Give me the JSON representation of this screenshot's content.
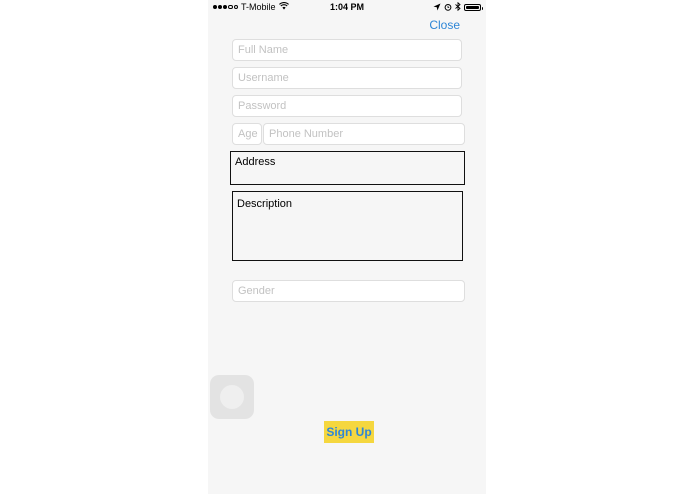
{
  "status_bar": {
    "carrier": "T-Mobile",
    "time": "1:04 PM"
  },
  "header": {
    "close_label": "Close"
  },
  "form": {
    "full_name_placeholder": "Full Name",
    "username_placeholder": "Username",
    "password_placeholder": "Password",
    "age_placeholder": "Age",
    "phone_placeholder": "Phone Number",
    "address_label": "Address",
    "description_label": "Description",
    "gender_placeholder": "Gender"
  },
  "actions": {
    "sign_up_label": "Sign Up"
  },
  "colors": {
    "accent": "#2e86d6",
    "button_bg": "#f5d73f",
    "screen_bg": "#f6f6f6"
  },
  "icons": [
    "signal-icon",
    "wifi-icon",
    "location-icon",
    "alarm-icon",
    "bluetooth-icon",
    "battery-icon",
    "assistive-touch-icon"
  ]
}
